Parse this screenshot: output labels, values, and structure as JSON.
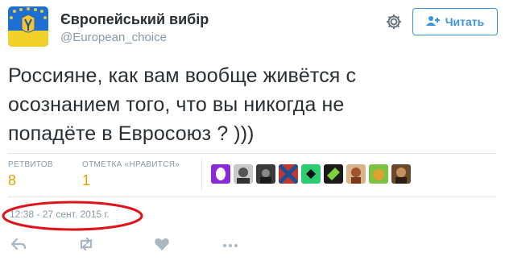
{
  "header": {
    "display_name": "Європейський вибір",
    "handle": "@European_choice",
    "follow_label": "Читать"
  },
  "tweet": {
    "text_lines": [
      "Россияне, как вам вообще живётся с",
      "осознанием того, что вы никогда не",
      "попадёте в Евросоюз ? )))"
    ]
  },
  "stats": {
    "retweets_label": "РЕТВИТОВ",
    "retweets_count": "8",
    "likes_label": "ОТМЕТКА «НРАВИТСЯ»",
    "likes_count": "1"
  },
  "timestamp": "12:38 - 27 сент. 2015 г.",
  "colors": {
    "accent": "#3b94d9",
    "count": "#e6a100",
    "muted": "#8899a6",
    "annotation": "#e0111b"
  },
  "icons": [
    "settings-gear-icon",
    "follow-user-plus-icon",
    "reply-icon",
    "retweet-icon",
    "heart-icon",
    "more-icon"
  ]
}
